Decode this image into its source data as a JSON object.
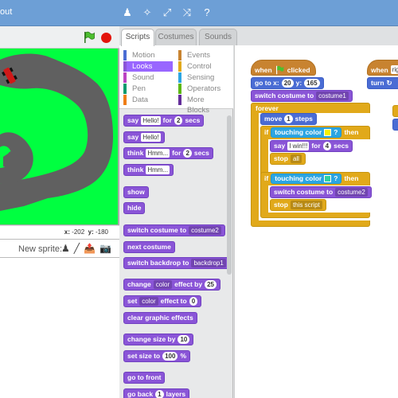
{
  "window": {
    "title_fragment": "out"
  },
  "toolbar": {
    "icons": [
      "duplicate-icon",
      "delete-icon",
      "grow-icon",
      "shrink-icon",
      "help-icon"
    ]
  },
  "stage": {
    "coords": {
      "x_label": "x:",
      "x_value": "-202",
      "y_label": "y:",
      "y_value": "-180"
    }
  },
  "sprites": {
    "new_sprite_label": "New sprite:"
  },
  "tabs": [
    "Scripts",
    "Costumes",
    "Sounds"
  ],
  "categories": {
    "left": [
      "Motion",
      "Looks",
      "Sound",
      "Pen",
      "Data"
    ],
    "right": [
      "Events",
      "Control",
      "Sensing",
      "Operators",
      "More Blocks"
    ],
    "selected": "Looks",
    "colors": {
      "Motion": "#4a6cd4",
      "Looks": "#8a55d7",
      "Sound": "#bb42c3",
      "Pen": "#0e9a6c",
      "Data": "#ee7d16",
      "Events": "#c88330",
      "Control": "#e1a91a",
      "Sensing": "#2ca5e2",
      "Operators": "#5cb712",
      "More Blocks": "#632d99"
    }
  },
  "palette": {
    "say_for": {
      "say": "say",
      "msg": "Hello!",
      "for": "for",
      "secs_val": "2",
      "secs": "secs"
    },
    "say": {
      "say": "say",
      "msg": "Hello!"
    },
    "think_for": {
      "think": "think",
      "msg": "Hmm...",
      "for": "for",
      "secs_val": "2",
      "secs": "secs"
    },
    "think": {
      "think": "think",
      "msg": "Hmm..."
    },
    "show": "show",
    "hide": "hide",
    "switch_costume": {
      "label": "switch costume to",
      "value": "costume2"
    },
    "next_costume": "next costume",
    "switch_backdrop": {
      "label": "switch backdrop to",
      "value": "backdrop1"
    },
    "change_effect": {
      "change": "change",
      "effect": "color",
      "by": "effect by",
      "value": "25"
    },
    "set_effect": {
      "set": "set",
      "effect": "color",
      "to": "effect to",
      "value": "0"
    },
    "clear_effects": "clear graphic effects",
    "change_size": {
      "label": "change size by",
      "value": "10"
    },
    "set_size": {
      "label": "set size to",
      "value": "100",
      "unit": "%"
    },
    "go_front": "go to front",
    "go_back": {
      "label": "go back",
      "value": "1",
      "unit": "layers"
    }
  },
  "script": {
    "when_flag": {
      "when": "when",
      "clicked": "clicked"
    },
    "goto": {
      "label": "go to x:",
      "x": "20",
      "y_label": "y:",
      "y": "165"
    },
    "switch_costume": {
      "label": "switch costume to",
      "value": "costume1"
    },
    "forever": "forever",
    "move": {
      "move": "move",
      "value": "1",
      "steps": "steps"
    },
    "if1": {
      "if": "if",
      "touching": "touching color",
      "q": "?",
      "then": "then",
      "color": "#f5f000"
    },
    "say_for": {
      "say": "say",
      "msg": "I win!!!",
      "for": "for",
      "secs_val": "4",
      "secs": "secs"
    },
    "stop": {
      "stop": "stop",
      "value": "all"
    },
    "if2": {
      "if": "if",
      "touching": "touching color",
      "q": "?",
      "then": "then",
      "color": "#30d0a0"
    },
    "switch_costume2": {
      "label": "switch costume to",
      "value": "costume2"
    },
    "stop2": {
      "stop": "stop",
      "value": "this script"
    },
    "when2": {
      "when": "when",
      "rest": "righ"
    },
    "turn": {
      "label": "turn"
    }
  }
}
